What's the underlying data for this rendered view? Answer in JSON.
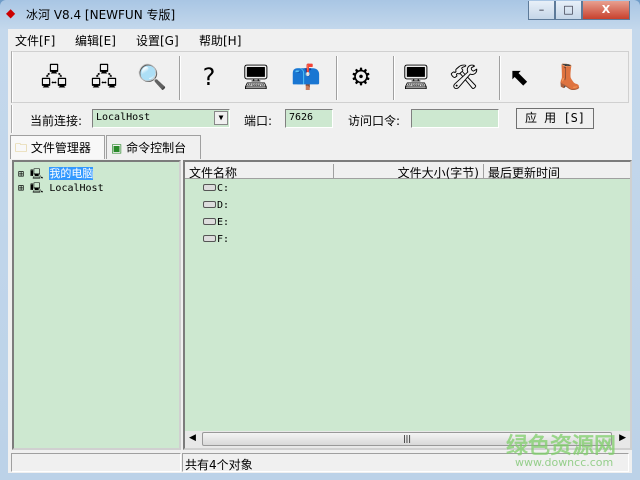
{
  "window": {
    "title": "冰河 V8.4 [NEWFUN 专版]",
    "minimize": "–",
    "maximize": "□",
    "close": "X"
  },
  "menu": [
    "文件[F]",
    "编辑[E]",
    "设置[G]",
    "帮助[H]"
  ],
  "toolbar": [
    {
      "name": "connect-icon",
      "glyph": "🖧"
    },
    {
      "name": "disconnect-icon",
      "glyph": "🖧"
    },
    {
      "name": "search-computer-icon",
      "glyph": "🔍"
    },
    {
      "name": "help-screen-icon",
      "glyph": "?"
    },
    {
      "name": "screen-capture-icon",
      "glyph": "🖥"
    },
    {
      "name": "mailbox-icon",
      "glyph": "📫"
    },
    {
      "name": "settings-gear-icon",
      "glyph": "⚙"
    },
    {
      "name": "config-server-icon",
      "glyph": "🖥"
    },
    {
      "name": "tools-icon",
      "glyph": "🛠"
    },
    {
      "name": "upgrade-arrow-icon",
      "glyph": "⬉"
    },
    {
      "name": "exit-boot-icon",
      "glyph": "👢"
    }
  ],
  "connection": {
    "label": "当前连接:",
    "host": "LocalHost",
    "port_label": "端口:",
    "port": "7626",
    "password_label": "访问口令:",
    "password": "",
    "apply": "应 用 [S]"
  },
  "tabs": [
    {
      "label": "文件管理器",
      "active": true
    },
    {
      "label": "命令控制台",
      "active": false
    }
  ],
  "tree": [
    "我的电脑",
    "LocalHost"
  ],
  "columns": [
    "文件名称",
    "文件大小(字节)",
    "最后更新时间"
  ],
  "files": [
    "C:",
    "D:",
    "E:",
    "F:"
  ],
  "status": "共有4个对象",
  "watermark": {
    "text": "绿色资源网",
    "url": "www.downcc.com"
  }
}
